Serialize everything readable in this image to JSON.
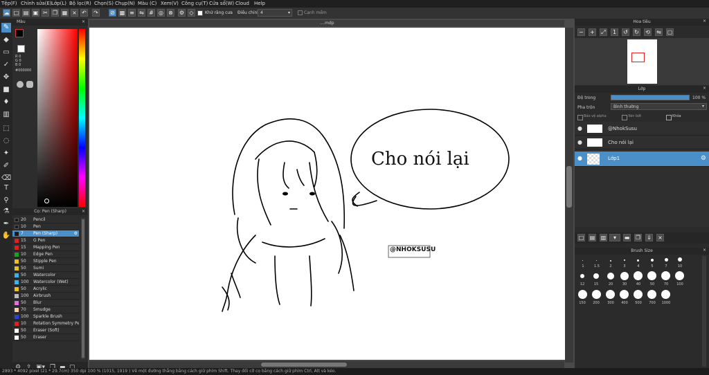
{
  "menubar": {
    "items": [
      "Tệp(F)",
      "Chỉnh sửa(E)",
      "Lớp(L)",
      "Bộ lọc(R)",
      "Chọn(S)",
      "Chụp(N)",
      "Màu (C)",
      "Xem(V)",
      "Công cụ(T)",
      "Cửa sổ(W)",
      "Cloud",
      "Help"
    ]
  },
  "toolbar": {
    "antialias_label": "Khử răng cưa",
    "stabilizer_label": "Điều chỉnh",
    "stabilizer_value": "4",
    "edge_label": "Cạnh mềm"
  },
  "color_panel": {
    "title": "Màu",
    "r_label": "R 0",
    "g_label": "G 0",
    "b_label": "B 0",
    "hex": "#000000"
  },
  "brush_panel": {
    "title": "Cọ: Pen (Sharp)",
    "items": [
      {
        "size": "20",
        "name": "Pencil",
        "color": "#1a1a1a"
      },
      {
        "size": "10",
        "name": "Pen",
        "color": "#1a1a1a"
      },
      {
        "size": "7",
        "name": "Pen (Sharp)",
        "color": "#1a1a1a",
        "selected": true
      },
      {
        "size": "15",
        "name": "G Pen",
        "color": "#e02020"
      },
      {
        "size": "15",
        "name": "Mapping Pen",
        "color": "#e02020"
      },
      {
        "size": "10",
        "name": "Edge Pen",
        "color": "#20a020"
      },
      {
        "size": "50",
        "name": "Stipple Pen",
        "color": "#e8c020"
      },
      {
        "size": "50",
        "name": "Sumi",
        "color": "#e8c020"
      },
      {
        "size": "50",
        "name": "Watercolor",
        "color": "#40b0e8"
      },
      {
        "size": "100",
        "name": "Watercolor (Wet)",
        "color": "#40b0e8"
      },
      {
        "size": "50",
        "name": "Acrylic",
        "color": "#e8c020"
      },
      {
        "size": "100",
        "name": "Airbrush",
        "color": "#bbbbbb"
      },
      {
        "size": "50",
        "name": "Blur",
        "color": "#e070e0"
      },
      {
        "size": "70",
        "name": "Smudge",
        "color": "#f0d0a0"
      },
      {
        "size": "100",
        "name": "Sparkle Brush",
        "color": "#3040d0"
      },
      {
        "size": "10",
        "name": "Rotation Symmetry Pe",
        "color": "#e02020"
      },
      {
        "size": "50",
        "name": "Eraser (Soft)",
        "color": "#ffffff"
      },
      {
        "size": "50",
        "name": "Eraser",
        "color": "#ffffff"
      }
    ]
  },
  "document": {
    "tab_title": "....mdp"
  },
  "canvas": {
    "speech_text": "Cho nói lại",
    "signature_text": "@NHOKSUSU"
  },
  "navigator": {
    "title": "Hoa tiêu"
  },
  "layer_panel": {
    "title": "Lớp",
    "opacity_label": "Độ trong",
    "opacity_value": "100 %",
    "blend_label": "Pha trộn",
    "blend_value": "Bình thường",
    "protect_alpha": "Bảo vệ alpha",
    "clipping": "Xén bớt",
    "lock": "Khóa",
    "layers": [
      {
        "name": "@NhokSusu",
        "selected": false
      },
      {
        "name": "Cho nói lại",
        "selected": false
      },
      {
        "name": "Lớp1",
        "selected": true
      }
    ]
  },
  "brush_size_panel": {
    "title": "Brush Size",
    "sizes": [
      "1",
      "1.5",
      "2",
      "3",
      "4",
      "5",
      "7",
      "10",
      "12",
      "15",
      "20",
      "30",
      "40",
      "50",
      "70",
      "100",
      "150",
      "200",
      "300",
      "400",
      "500",
      "700",
      "1000"
    ]
  },
  "status": {
    "text": "2893 * 4092 pixel  (21 * 29.7cm)  350 dpi  100 %  (1015, 1919 )  Vẽ một đường thẳng bằng cách giữ phím Shift. Thay đổi cỡ cọ bằng cách giữ phím Ctrl, Alt và kéo."
  }
}
